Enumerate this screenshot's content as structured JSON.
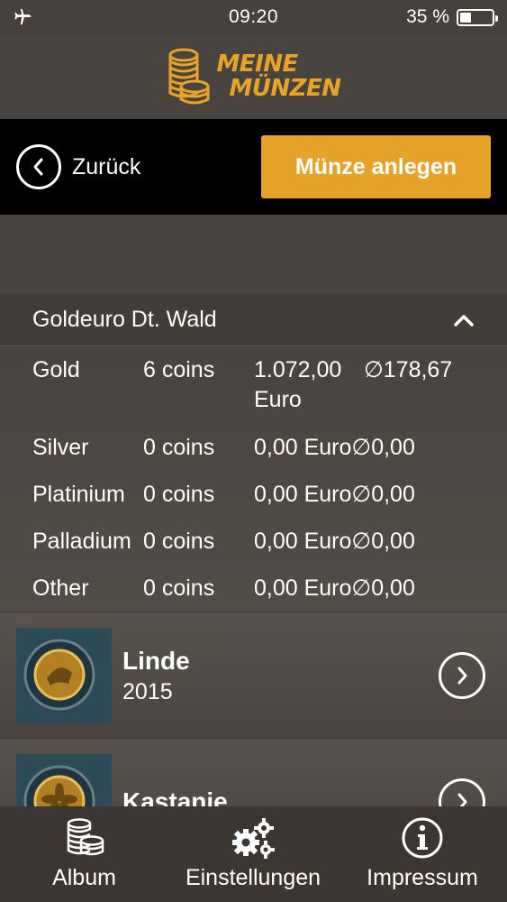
{
  "status_bar": {
    "time": "09:20",
    "battery_percent": "35 %",
    "battery_level": 0.35,
    "airplane_icon": "airplane-icon"
  },
  "header": {
    "logo_line1": "MEINE",
    "logo_line2": "MÜNZEN"
  },
  "nav": {
    "back_label": "Zurück",
    "primary_label": "Münze anlegen"
  },
  "section": {
    "title": "Goldeuro Dt. Wald",
    "expanded": true
  },
  "stats": [
    {
      "metal": "Gold",
      "coins": "6 coins",
      "value_line1": "1.072,00",
      "value_line2": "Euro",
      "avg": "∅178,67"
    },
    {
      "metal": "Silver",
      "coins": "0 coins",
      "value": "0,00 Euro∅0,00"
    },
    {
      "metal": "Platinium",
      "coins": "0 coins",
      "value": "0,00 Euro∅0,00"
    },
    {
      "metal": "Palladium",
      "coins": "0 coins",
      "value": "0,00 Euro∅0,00"
    },
    {
      "metal": "Other",
      "coins": "0 coins",
      "value": "0,00 Euro∅0,00"
    }
  ],
  "coins": [
    {
      "name": "Linde",
      "year": "2015"
    },
    {
      "name": "Kastanie",
      "year": ""
    }
  ],
  "tabs": [
    {
      "label": "Album",
      "icon": "coin-stack-icon"
    },
    {
      "label": "Einstellungen",
      "icon": "gears-icon"
    },
    {
      "label": "Impressum",
      "icon": "info-icon"
    }
  ],
  "colors": {
    "accent": "#e5a32a",
    "background": "#4a4440",
    "nav_background": "#000000"
  }
}
